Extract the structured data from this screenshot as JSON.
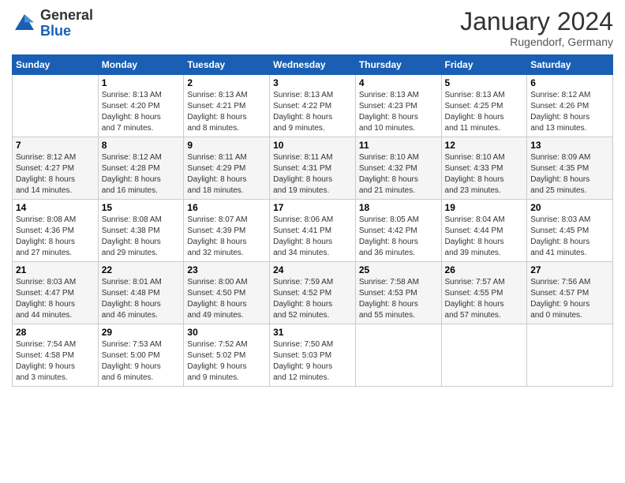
{
  "logo": {
    "general": "General",
    "blue": "Blue"
  },
  "header": {
    "month_year": "January 2024",
    "location": "Rugendorf, Germany"
  },
  "weekdays": [
    "Sunday",
    "Monday",
    "Tuesday",
    "Wednesday",
    "Thursday",
    "Friday",
    "Saturday"
  ],
  "weeks": [
    [
      {
        "day": "",
        "info": ""
      },
      {
        "day": "1",
        "info": "Sunrise: 8:13 AM\nSunset: 4:20 PM\nDaylight: 8 hours\nand 7 minutes."
      },
      {
        "day": "2",
        "info": "Sunrise: 8:13 AM\nSunset: 4:21 PM\nDaylight: 8 hours\nand 8 minutes."
      },
      {
        "day": "3",
        "info": "Sunrise: 8:13 AM\nSunset: 4:22 PM\nDaylight: 8 hours\nand 9 minutes."
      },
      {
        "day": "4",
        "info": "Sunrise: 8:13 AM\nSunset: 4:23 PM\nDaylight: 8 hours\nand 10 minutes."
      },
      {
        "day": "5",
        "info": "Sunrise: 8:13 AM\nSunset: 4:25 PM\nDaylight: 8 hours\nand 11 minutes."
      },
      {
        "day": "6",
        "info": "Sunrise: 8:12 AM\nSunset: 4:26 PM\nDaylight: 8 hours\nand 13 minutes."
      }
    ],
    [
      {
        "day": "7",
        "info": ""
      },
      {
        "day": "8",
        "info": "Sunrise: 8:12 AM\nSunset: 4:28 PM\nDaylight: 8 hours\nand 16 minutes."
      },
      {
        "day": "9",
        "info": "Sunrise: 8:11 AM\nSunset: 4:29 PM\nDaylight: 8 hours\nand 18 minutes."
      },
      {
        "day": "10",
        "info": "Sunrise: 8:11 AM\nSunset: 4:31 PM\nDaylight: 8 hours\nand 19 minutes."
      },
      {
        "day": "11",
        "info": "Sunrise: 8:10 AM\nSunset: 4:32 PM\nDaylight: 8 hours\nand 21 minutes."
      },
      {
        "day": "12",
        "info": "Sunrise: 8:10 AM\nSunset: 4:33 PM\nDaylight: 8 hours\nand 23 minutes."
      },
      {
        "day": "13",
        "info": "Sunrise: 8:09 AM\nSunset: 4:35 PM\nDaylight: 8 hours\nand 25 minutes."
      }
    ],
    [
      {
        "day": "14",
        "info": ""
      },
      {
        "day": "15",
        "info": "Sunrise: 8:08 AM\nSunset: 4:38 PM\nDaylight: 8 hours\nand 29 minutes."
      },
      {
        "day": "16",
        "info": "Sunrise: 8:07 AM\nSunset: 4:39 PM\nDaylight: 8 hours\nand 32 minutes."
      },
      {
        "day": "17",
        "info": "Sunrise: 8:06 AM\nSunset: 4:41 PM\nDaylight: 8 hours\nand 34 minutes."
      },
      {
        "day": "18",
        "info": "Sunrise: 8:05 AM\nSunset: 4:42 PM\nDaylight: 8 hours\nand 36 minutes."
      },
      {
        "day": "19",
        "info": "Sunrise: 8:04 AM\nSunset: 4:44 PM\nDaylight: 8 hours\nand 39 minutes."
      },
      {
        "day": "20",
        "info": "Sunrise: 8:03 AM\nSunset: 4:45 PM\nDaylight: 8 hours\nand 41 minutes."
      }
    ],
    [
      {
        "day": "21",
        "info": ""
      },
      {
        "day": "22",
        "info": "Sunrise: 8:01 AM\nSunset: 4:48 PM\nDaylight: 8 hours\nand 46 minutes."
      },
      {
        "day": "23",
        "info": "Sunrise: 8:00 AM\nSunset: 4:50 PM\nDaylight: 8 hours\nand 49 minutes."
      },
      {
        "day": "24",
        "info": "Sunrise: 7:59 AM\nSunset: 4:52 PM\nDaylight: 8 hours\nand 52 minutes."
      },
      {
        "day": "25",
        "info": "Sunrise: 7:58 AM\nSunset: 4:53 PM\nDaylight: 8 hours\nand 55 minutes."
      },
      {
        "day": "26",
        "info": "Sunrise: 7:57 AM\nSunset: 4:55 PM\nDaylight: 8 hours\nand 57 minutes."
      },
      {
        "day": "27",
        "info": "Sunrise: 7:56 AM\nSunset: 4:57 PM\nDaylight: 9 hours\nand 0 minutes."
      }
    ],
    [
      {
        "day": "28",
        "info": ""
      },
      {
        "day": "29",
        "info": "Sunrise: 7:53 AM\nSunset: 5:00 PM\nDaylight: 9 hours\nand 6 minutes."
      },
      {
        "day": "30",
        "info": "Sunrise: 7:52 AM\nSunset: 5:02 PM\nDaylight: 9 hours\nand 9 minutes."
      },
      {
        "day": "31",
        "info": "Sunrise: 7:50 AM\nSunset: 5:03 PM\nDaylight: 9 hours\nand 12 minutes."
      },
      {
        "day": "",
        "info": ""
      },
      {
        "day": "",
        "info": ""
      },
      {
        "day": "",
        "info": ""
      }
    ]
  ],
  "week1_sun": "Sunrise: 8:12 AM\nSunset: 4:27 PM\nDaylight: 8 hours\nand 14 minutes.",
  "week3_sun": "Sunrise: 8:08 AM\nSunset: 4:36 PM\nDaylight: 8 hours\nand 27 minutes.",
  "week4_sun": "Sunrise: 8:03 AM\nSunset: 4:47 PM\nDaylight: 8 hours\nand 44 minutes.",
  "week5_sun": "Sunrise: 7:54 AM\nSunset: 4:58 PM\nDaylight: 9 hours\nand 3 minutes."
}
